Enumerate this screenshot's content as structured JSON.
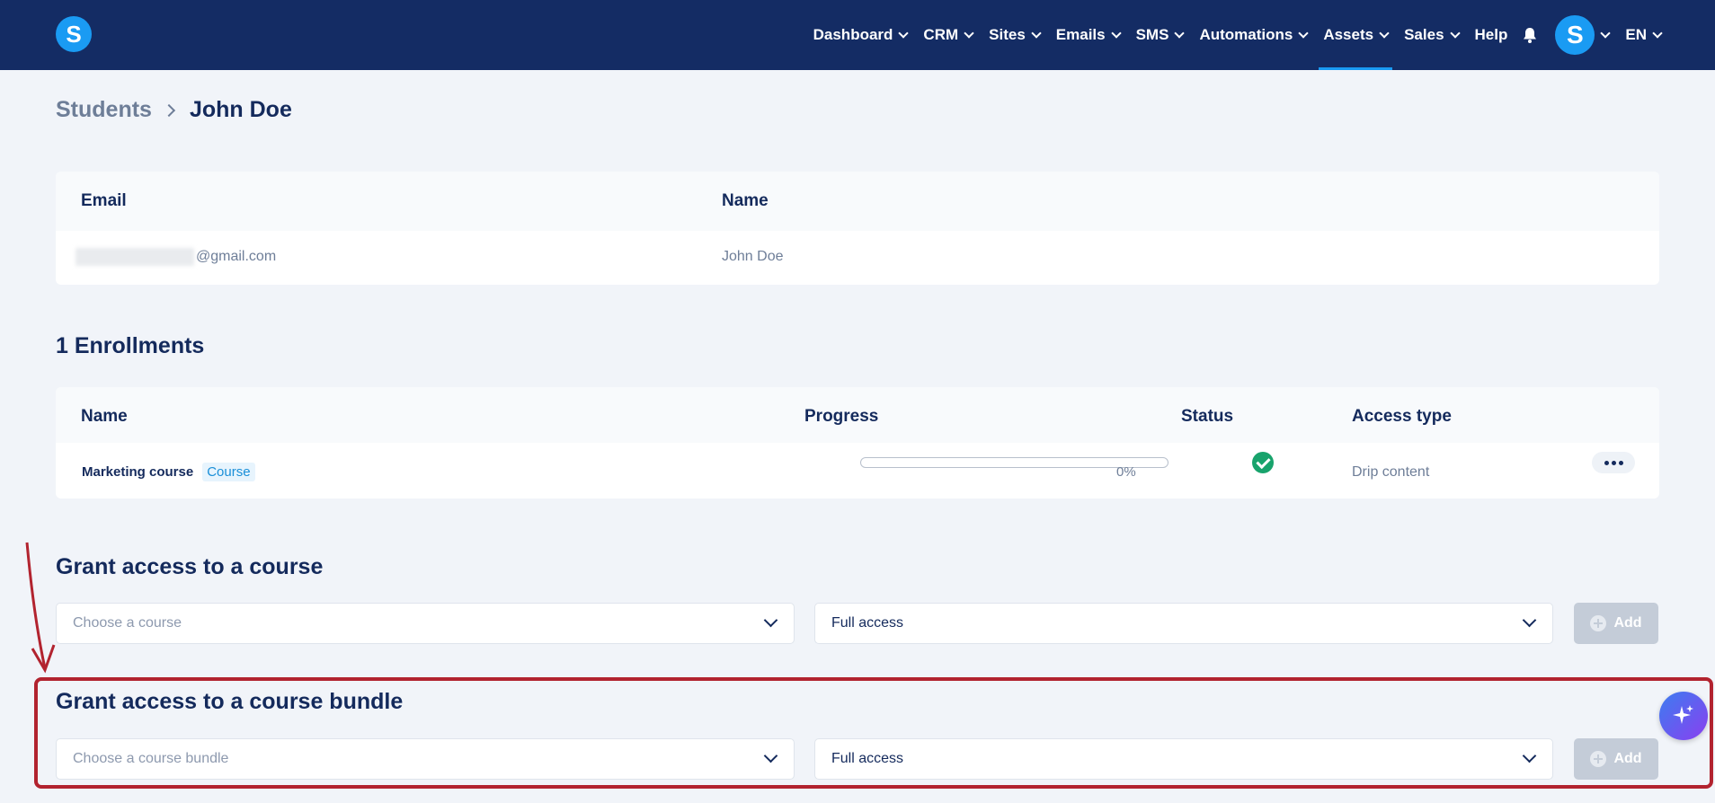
{
  "nav": {
    "items": [
      {
        "label": "Dashboard",
        "dropdown": true
      },
      {
        "label": "CRM",
        "dropdown": true
      },
      {
        "label": "Sites",
        "dropdown": true
      },
      {
        "label": "Emails",
        "dropdown": true
      },
      {
        "label": "SMS",
        "dropdown": true
      },
      {
        "label": "Automations",
        "dropdown": true
      },
      {
        "label": "Assets",
        "dropdown": true,
        "active": true
      },
      {
        "label": "Sales",
        "dropdown": true
      },
      {
        "label": "Help",
        "dropdown": false
      }
    ],
    "logo_letter": "S",
    "avatar_letter": "S",
    "language": "EN",
    "accent": "#1a9bf3",
    "bg": "#142c64"
  },
  "breadcrumb": {
    "parent": "Students",
    "current": "John Doe"
  },
  "student": {
    "headers": {
      "email": "Email",
      "name": "Name"
    },
    "email_suffix": "@gmail.com",
    "name": "John Doe"
  },
  "enrollments": {
    "title": "1 Enrollments",
    "headers": {
      "name": "Name",
      "progress": "Progress",
      "status": "Status",
      "access": "Access type"
    },
    "rows": [
      {
        "name": "Marketing course",
        "badge": "Course",
        "progress": 0,
        "progress_label": "0%",
        "status": "check-circle-icon",
        "access": "Drip content"
      }
    ]
  },
  "grant_course": {
    "title": "Grant access to a course",
    "placeholder": "Choose a course",
    "access_value": "Full access",
    "add_label": "Add"
  },
  "grant_bundle": {
    "title": "Grant access to a course bundle",
    "placeholder": "Choose a course bundle",
    "access_value": "Full access",
    "add_label": "Add"
  },
  "annotation": {
    "color": "#b2232f"
  }
}
